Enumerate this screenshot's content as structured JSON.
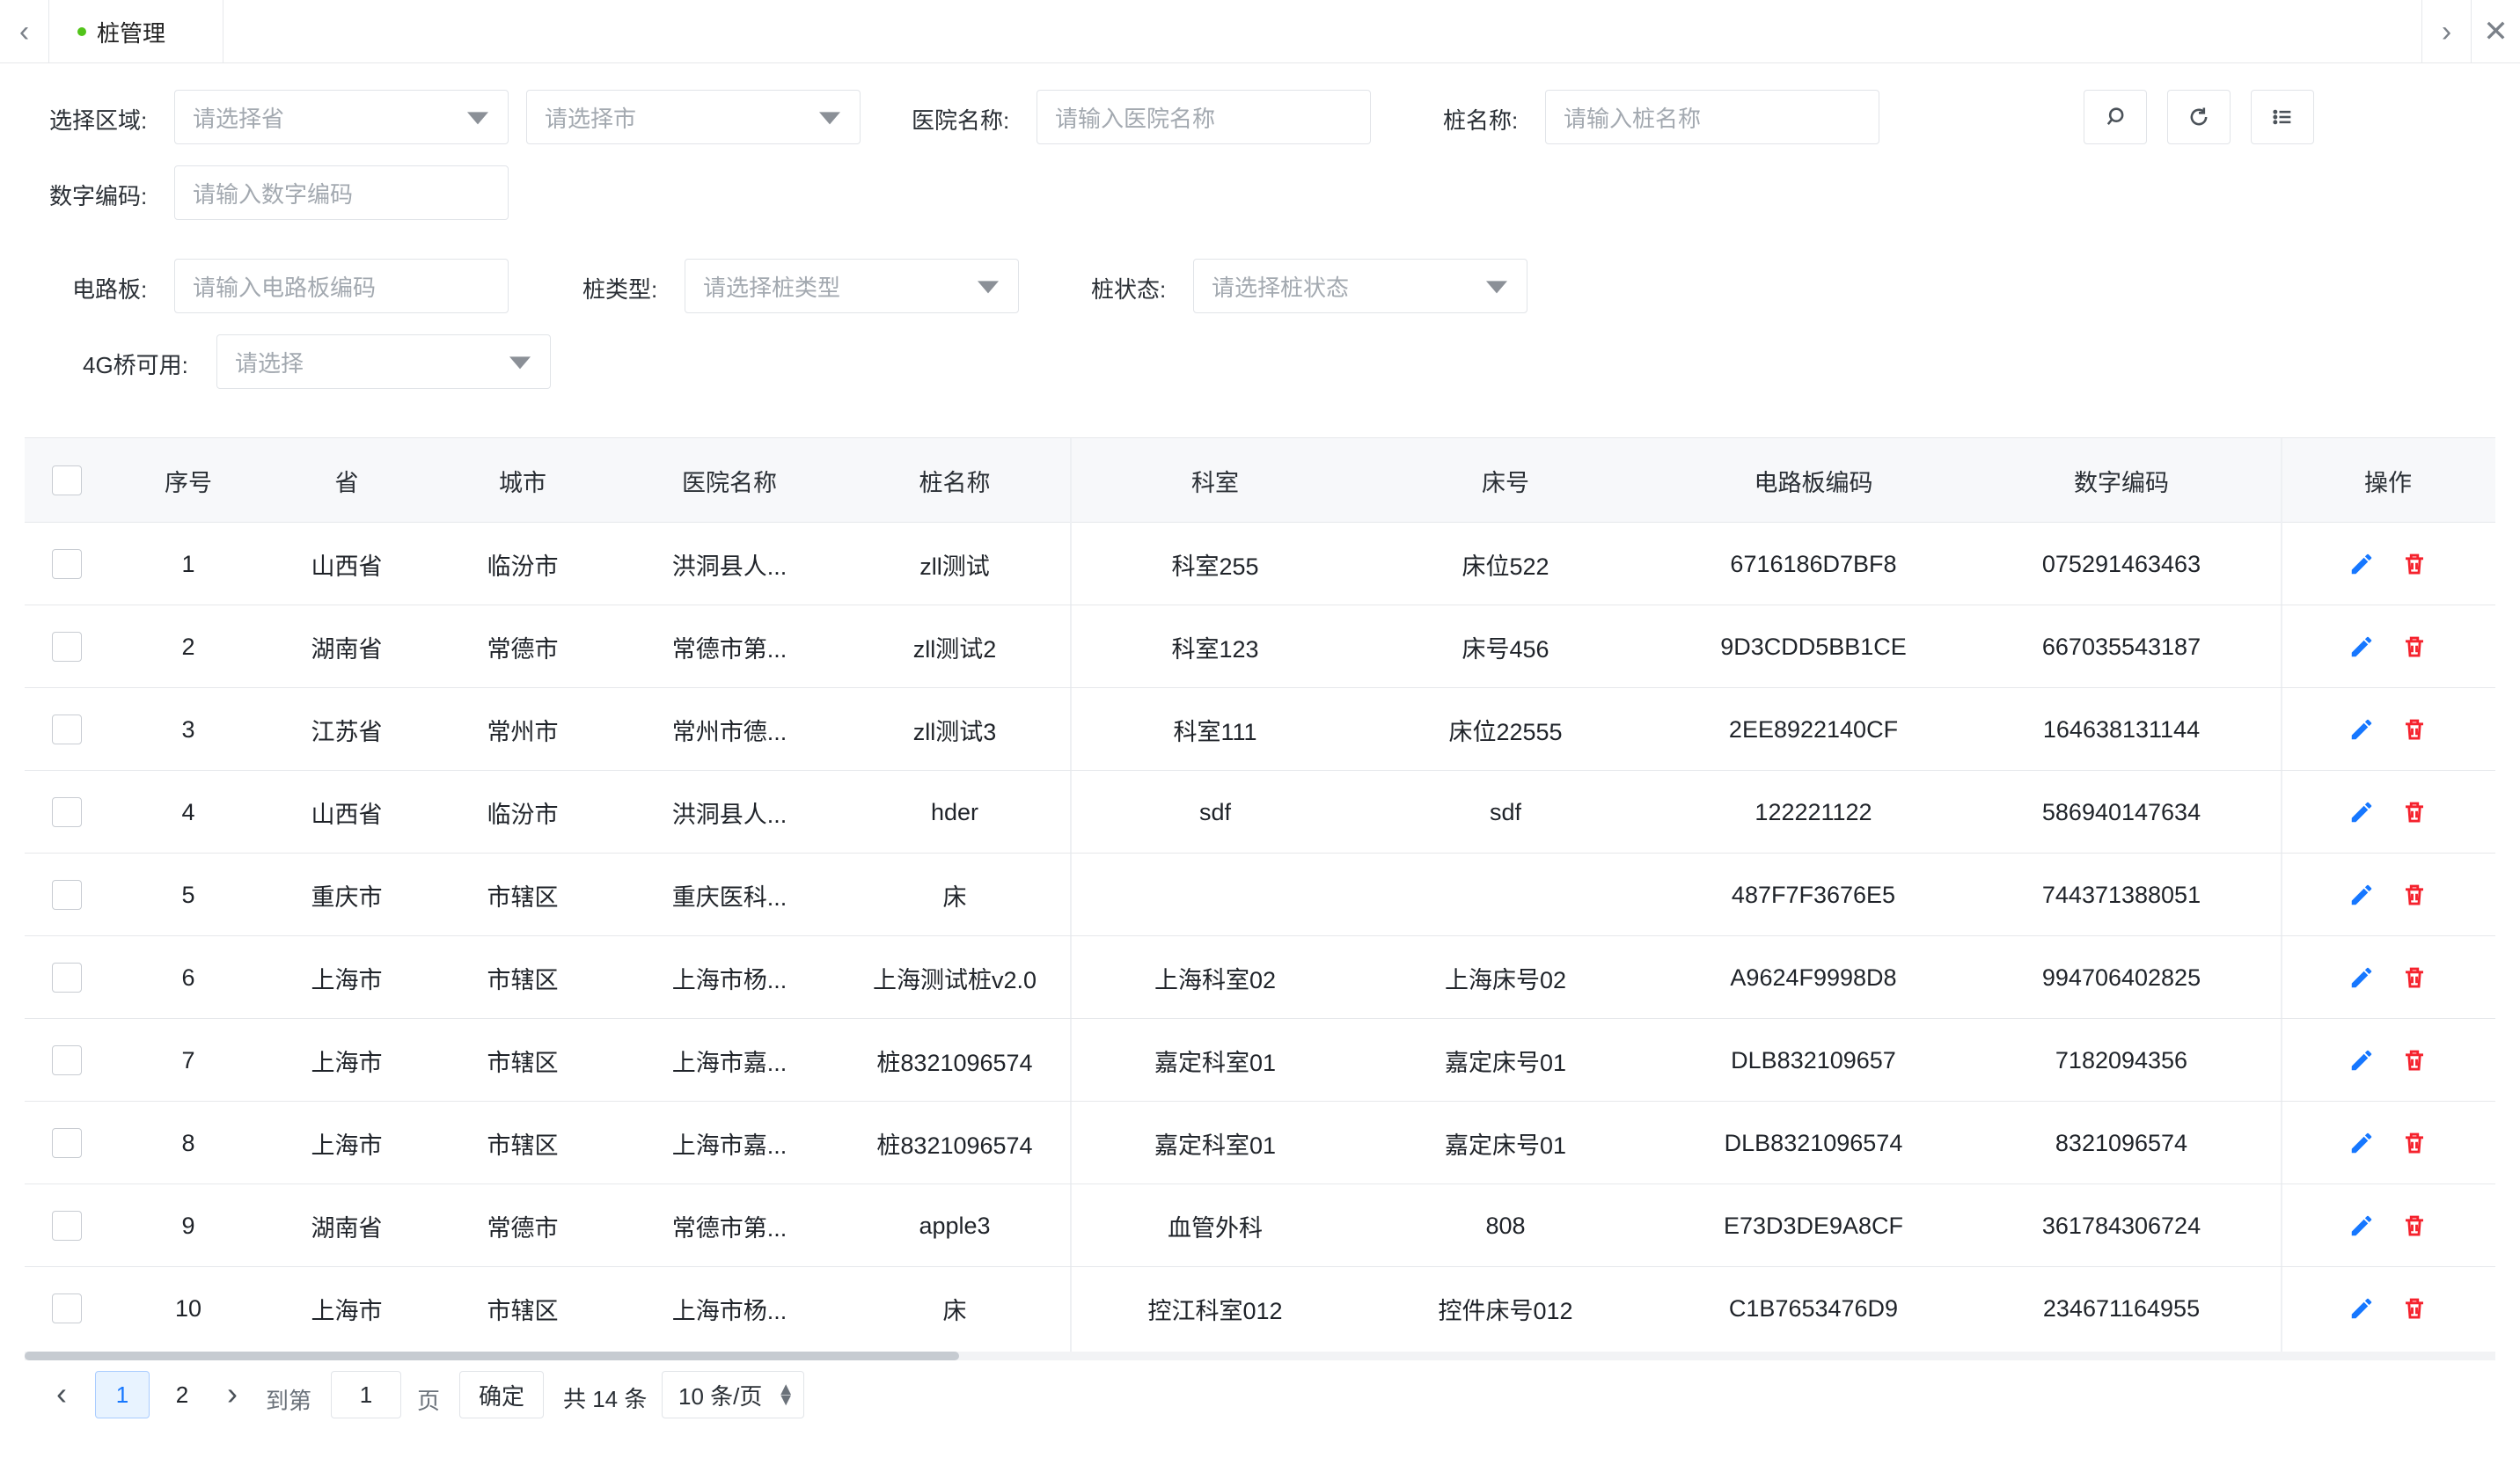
{
  "tabs": {
    "active_label": "桩管理",
    "prev_icon": "‹",
    "next_icon": "›",
    "close_icon": "✕"
  },
  "filters": {
    "region_label": "选择区域:",
    "province_placeholder": "请选择省",
    "city_placeholder": "请选择市",
    "hospital_label": "医院名称:",
    "hospital_placeholder": "请输入医院名称",
    "pile_name_label": "桩名称:",
    "pile_name_placeholder": "请输入桩名称",
    "digital_code_label": "数字编码:",
    "digital_code_placeholder": "请输入数字编码",
    "board_label": "电路板:",
    "board_placeholder": "请输入电路板编码",
    "pile_type_label": "桩类型:",
    "pile_type_placeholder": "请选择桩类型",
    "pile_status_label": "桩状态:",
    "pile_status_placeholder": "请选择桩状态",
    "bridge_4g_label": "4G桥可用:",
    "bridge_4g_placeholder": "请选择"
  },
  "table": {
    "headers": {
      "index": "序号",
      "province": "省",
      "city": "城市",
      "hospital": "医院名称",
      "pile_name": "桩名称",
      "department": "科室",
      "bed": "床号",
      "board_code": "电路板编码",
      "digital_code": "数字编码",
      "actions": "操作"
    },
    "rows": [
      {
        "index": "1",
        "province": "山西省",
        "city": "临汾市",
        "hospital": "洪洞县人...",
        "pile_name": "zll测试",
        "department": "科室255",
        "bed": "床位522",
        "board_code": "6716186D7BF8",
        "digital_code": "075291463463"
      },
      {
        "index": "2",
        "province": "湖南省",
        "city": "常德市",
        "hospital": "常德市第...",
        "pile_name": "zll测试2",
        "department": "科室123",
        "bed": "床号456",
        "board_code": "9D3CDD5BB1CE",
        "digital_code": "667035543187"
      },
      {
        "index": "3",
        "province": "江苏省",
        "city": "常州市",
        "hospital": "常州市德...",
        "pile_name": "zll测试3",
        "department": "科室111",
        "bed": "床位22555",
        "board_code": "2EE8922140CF",
        "digital_code": "164638131144"
      },
      {
        "index": "4",
        "province": "山西省",
        "city": "临汾市",
        "hospital": "洪洞县人...",
        "pile_name": "hder",
        "department": "sdf",
        "bed": "sdf",
        "board_code": "122221122",
        "digital_code": "586940147634"
      },
      {
        "index": "5",
        "province": "重庆市",
        "city": "市辖区",
        "hospital": "重庆医科...",
        "pile_name": "床",
        "department": "",
        "bed": "",
        "board_code": "487F7F3676E5",
        "digital_code": "744371388051"
      },
      {
        "index": "6",
        "province": "上海市",
        "city": "市辖区",
        "hospital": "上海市杨...",
        "pile_name": "上海测试桩v2.0",
        "department": "上海科室02",
        "bed": "上海床号02",
        "board_code": "A9624F9998D8",
        "digital_code": "994706402825"
      },
      {
        "index": "7",
        "province": "上海市",
        "city": "市辖区",
        "hospital": "上海市嘉...",
        "pile_name": "桩8321096574",
        "department": "嘉定科室01",
        "bed": "嘉定床号01",
        "board_code": "DLB832109657",
        "digital_code": "7182094356"
      },
      {
        "index": "8",
        "province": "上海市",
        "city": "市辖区",
        "hospital": "上海市嘉...",
        "pile_name": "桩8321096574",
        "department": "嘉定科室01",
        "bed": "嘉定床号01",
        "board_code": "DLB8321096574",
        "digital_code": "8321096574"
      },
      {
        "index": "9",
        "province": "湖南省",
        "city": "常德市",
        "hospital": "常德市第...",
        "pile_name": "apple3",
        "department": "血管外科",
        "bed": "808",
        "board_code": "E73D3DE9A8CF",
        "digital_code": "361784306724"
      },
      {
        "index": "10",
        "province": "上海市",
        "city": "市辖区",
        "hospital": "上海市杨...",
        "pile_name": "床",
        "department": "控江科室012",
        "bed": "控件床号012",
        "board_code": "C1B7653476D9",
        "digital_code": "234671164955"
      }
    ]
  },
  "pagination": {
    "pages": [
      "1",
      "2"
    ],
    "current_page": "1",
    "goto_label": "到第",
    "goto_value": "1",
    "page_label": "页",
    "confirm_label": "确定",
    "total_text": "共 14 条",
    "page_size_text": "10 条/页",
    "prev_icon": "‹",
    "next_icon": "›"
  },
  "colors": {
    "accent": "#1677ff",
    "danger": "#f5222d",
    "status_dot": "#52c41a"
  },
  "icons": {
    "search": "search-icon",
    "refresh": "refresh-icon",
    "list": "list-icon",
    "edit": "pencil-icon",
    "delete": "trash-icon"
  }
}
